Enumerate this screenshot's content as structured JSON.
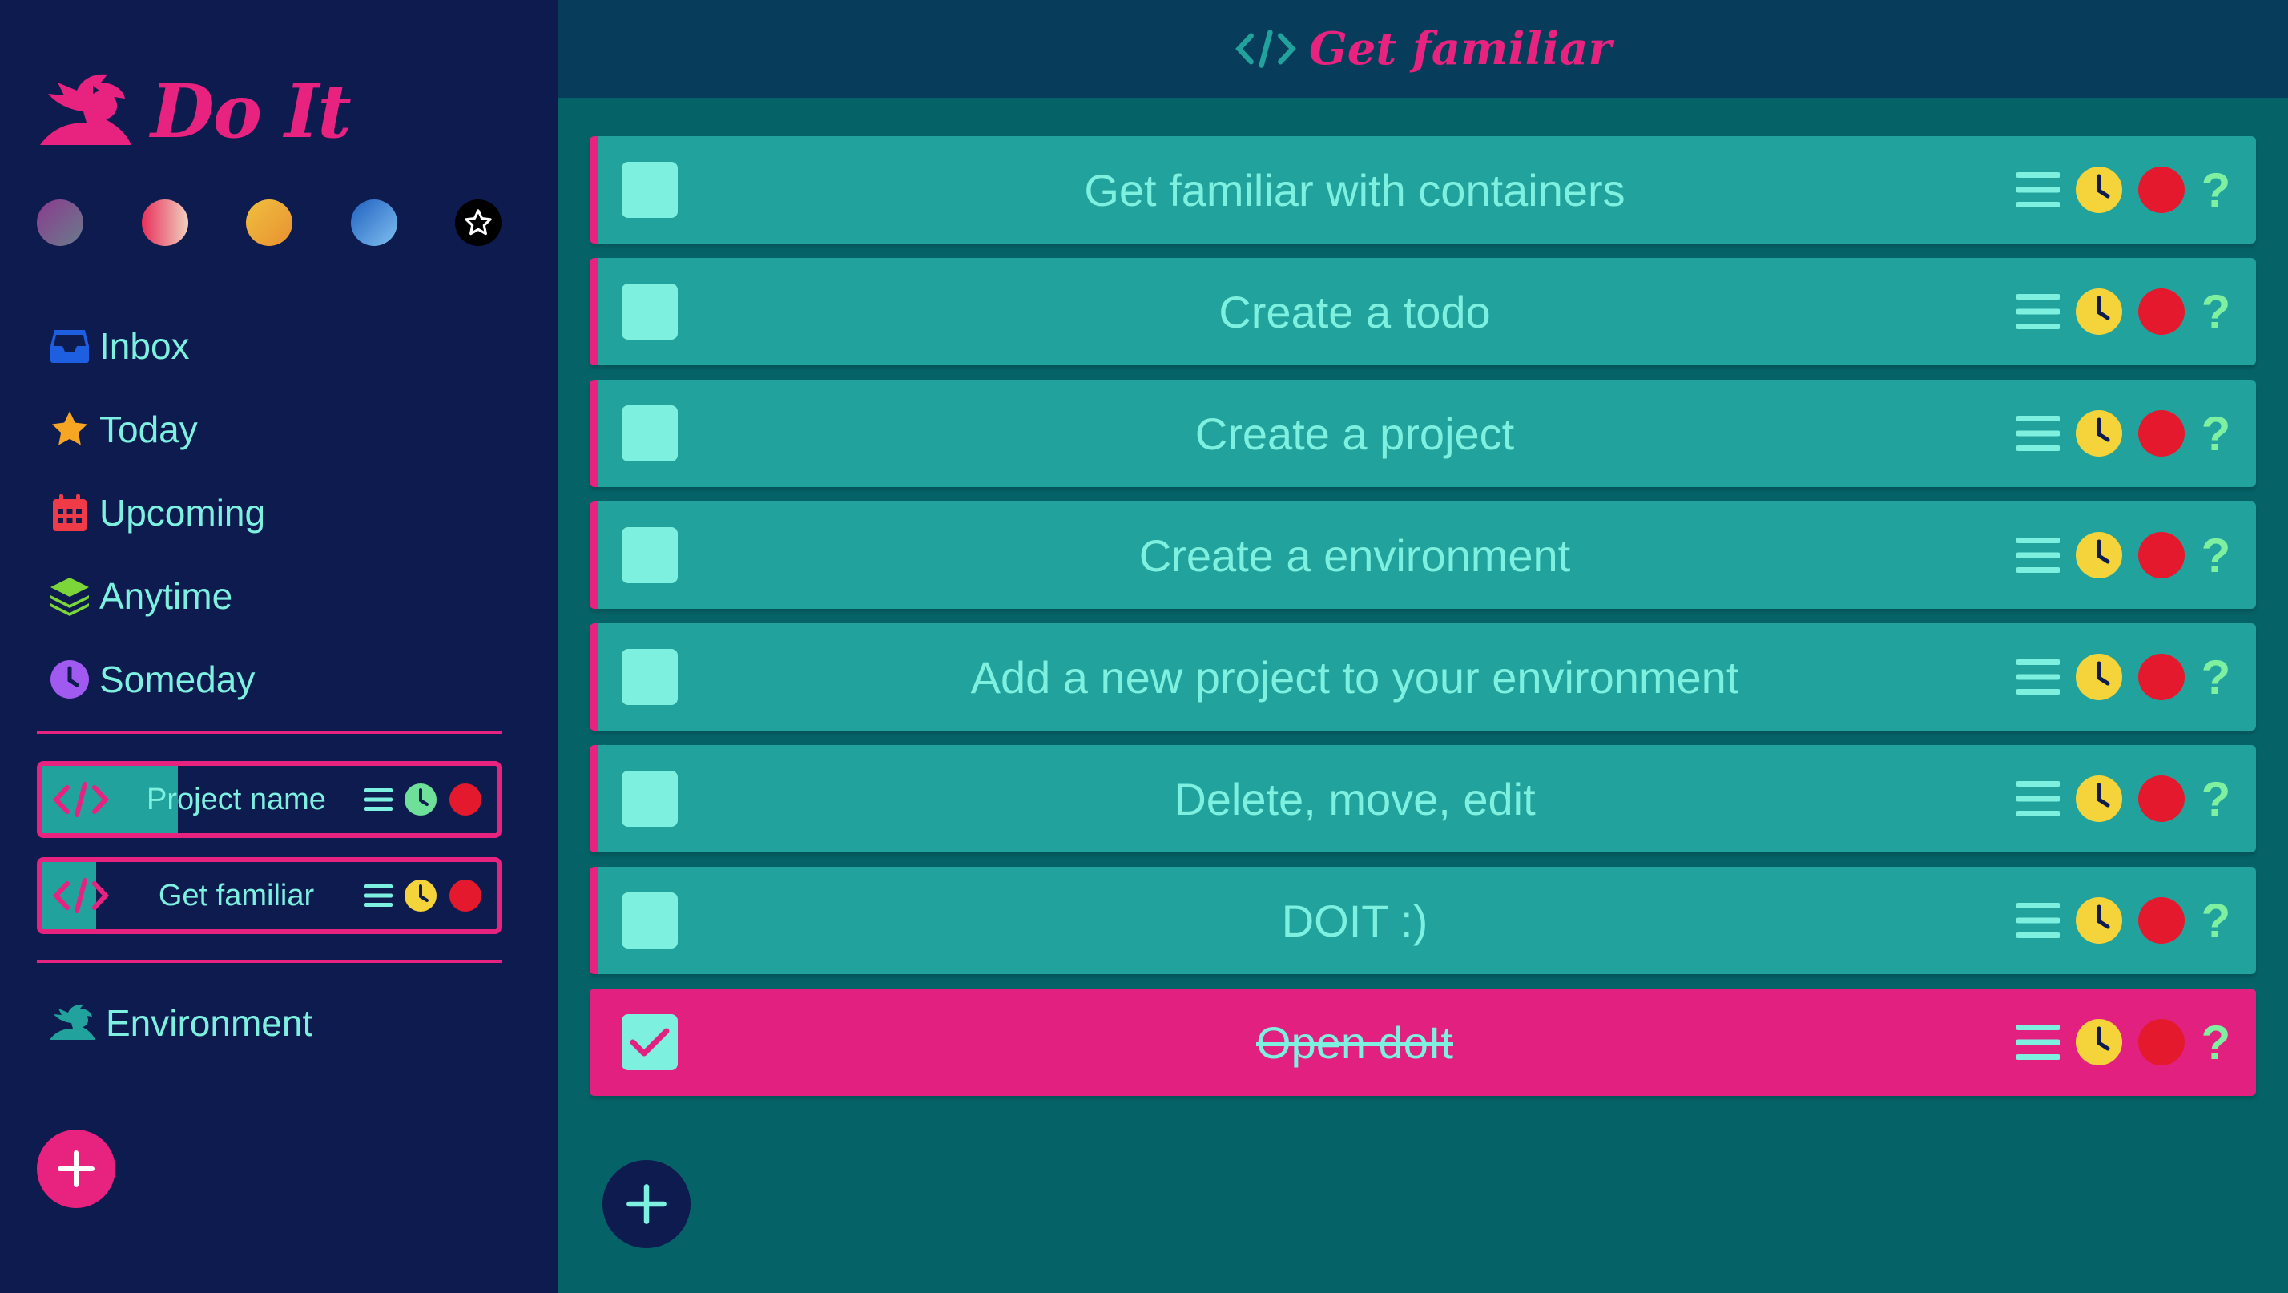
{
  "app": {
    "name": "Do It"
  },
  "colors": {
    "accent": "#e8227f",
    "sidebar_bg": "#0d1b4f",
    "main_bg": "#056368",
    "card_bg": "#22a29c",
    "text": "#7ef0e0",
    "clock_yellow": "#f5d33b",
    "clock_green": "#6fe09a",
    "delete_red": "#e5192d"
  },
  "sidebar": {
    "themes": [
      "theme-purple",
      "theme-red",
      "theme-yellow",
      "theme-blue",
      "theme-star"
    ],
    "nav": [
      {
        "label": "Inbox",
        "icon": "inbox-icon"
      },
      {
        "label": "Today",
        "icon": "star-icon"
      },
      {
        "label": "Upcoming",
        "icon": "calendar-icon"
      },
      {
        "label": "Anytime",
        "icon": "layers-icon"
      },
      {
        "label": "Someday",
        "icon": "clock-icon"
      }
    ],
    "projects": [
      {
        "name": "Project name",
        "progress": 0.3,
        "clock": "green"
      },
      {
        "name": "Get familiar",
        "progress": 0.12,
        "clock": "yellow"
      }
    ],
    "environment": {
      "label": "Environment",
      "icon": "dragon-icon"
    }
  },
  "header": {
    "title": "Get familiar",
    "icon": "code-icon"
  },
  "todos": [
    {
      "title": "Get familiar with containers",
      "done": false
    },
    {
      "title": "Create a todo",
      "done": false
    },
    {
      "title": "Create a project",
      "done": false
    },
    {
      "title": "Create a environment",
      "done": false
    },
    {
      "title": "Add a new project to your environment",
      "done": false
    },
    {
      "title": "Delete, move, edit",
      "done": false
    },
    {
      "title": "DOIT :)",
      "done": false
    },
    {
      "title": "Open doIt",
      "done": true
    }
  ],
  "todo_help": "?"
}
